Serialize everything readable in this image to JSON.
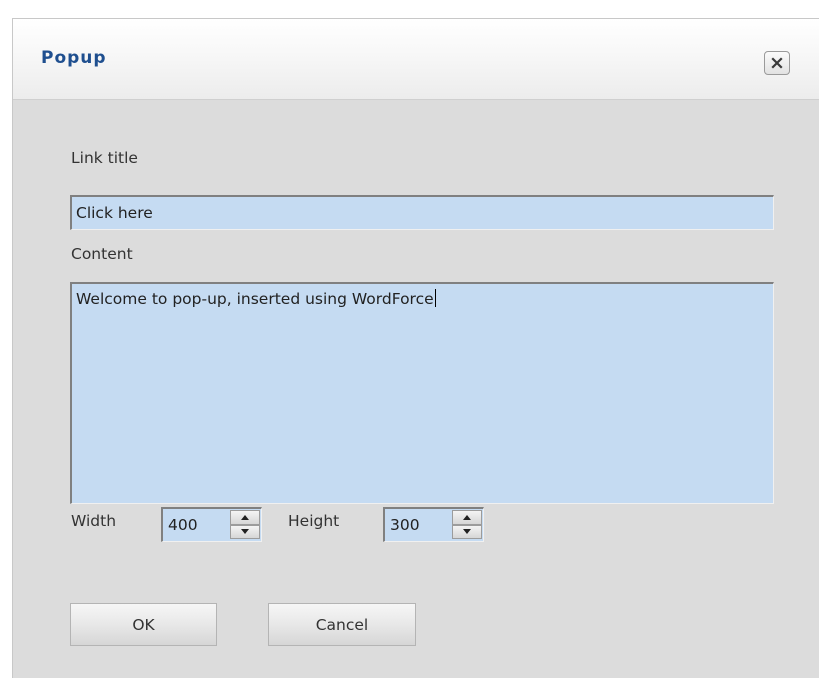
{
  "dialog": {
    "title": "Popup",
    "close_icon": "close-icon"
  },
  "form": {
    "link_title_label": "Link title",
    "link_title_value": "Click here",
    "content_label": "Content",
    "content_value": "Welcome to pop-up, inserted using WordForce",
    "width_label": "Width",
    "width_value": "400",
    "height_label": "Height",
    "height_value": "300"
  },
  "buttons": {
    "ok_label": "OK",
    "cancel_label": "Cancel"
  },
  "colors": {
    "title_text": "#1f4f8f",
    "input_bg": "#c5dbf2",
    "dialog_bg": "#dcdcdc"
  }
}
